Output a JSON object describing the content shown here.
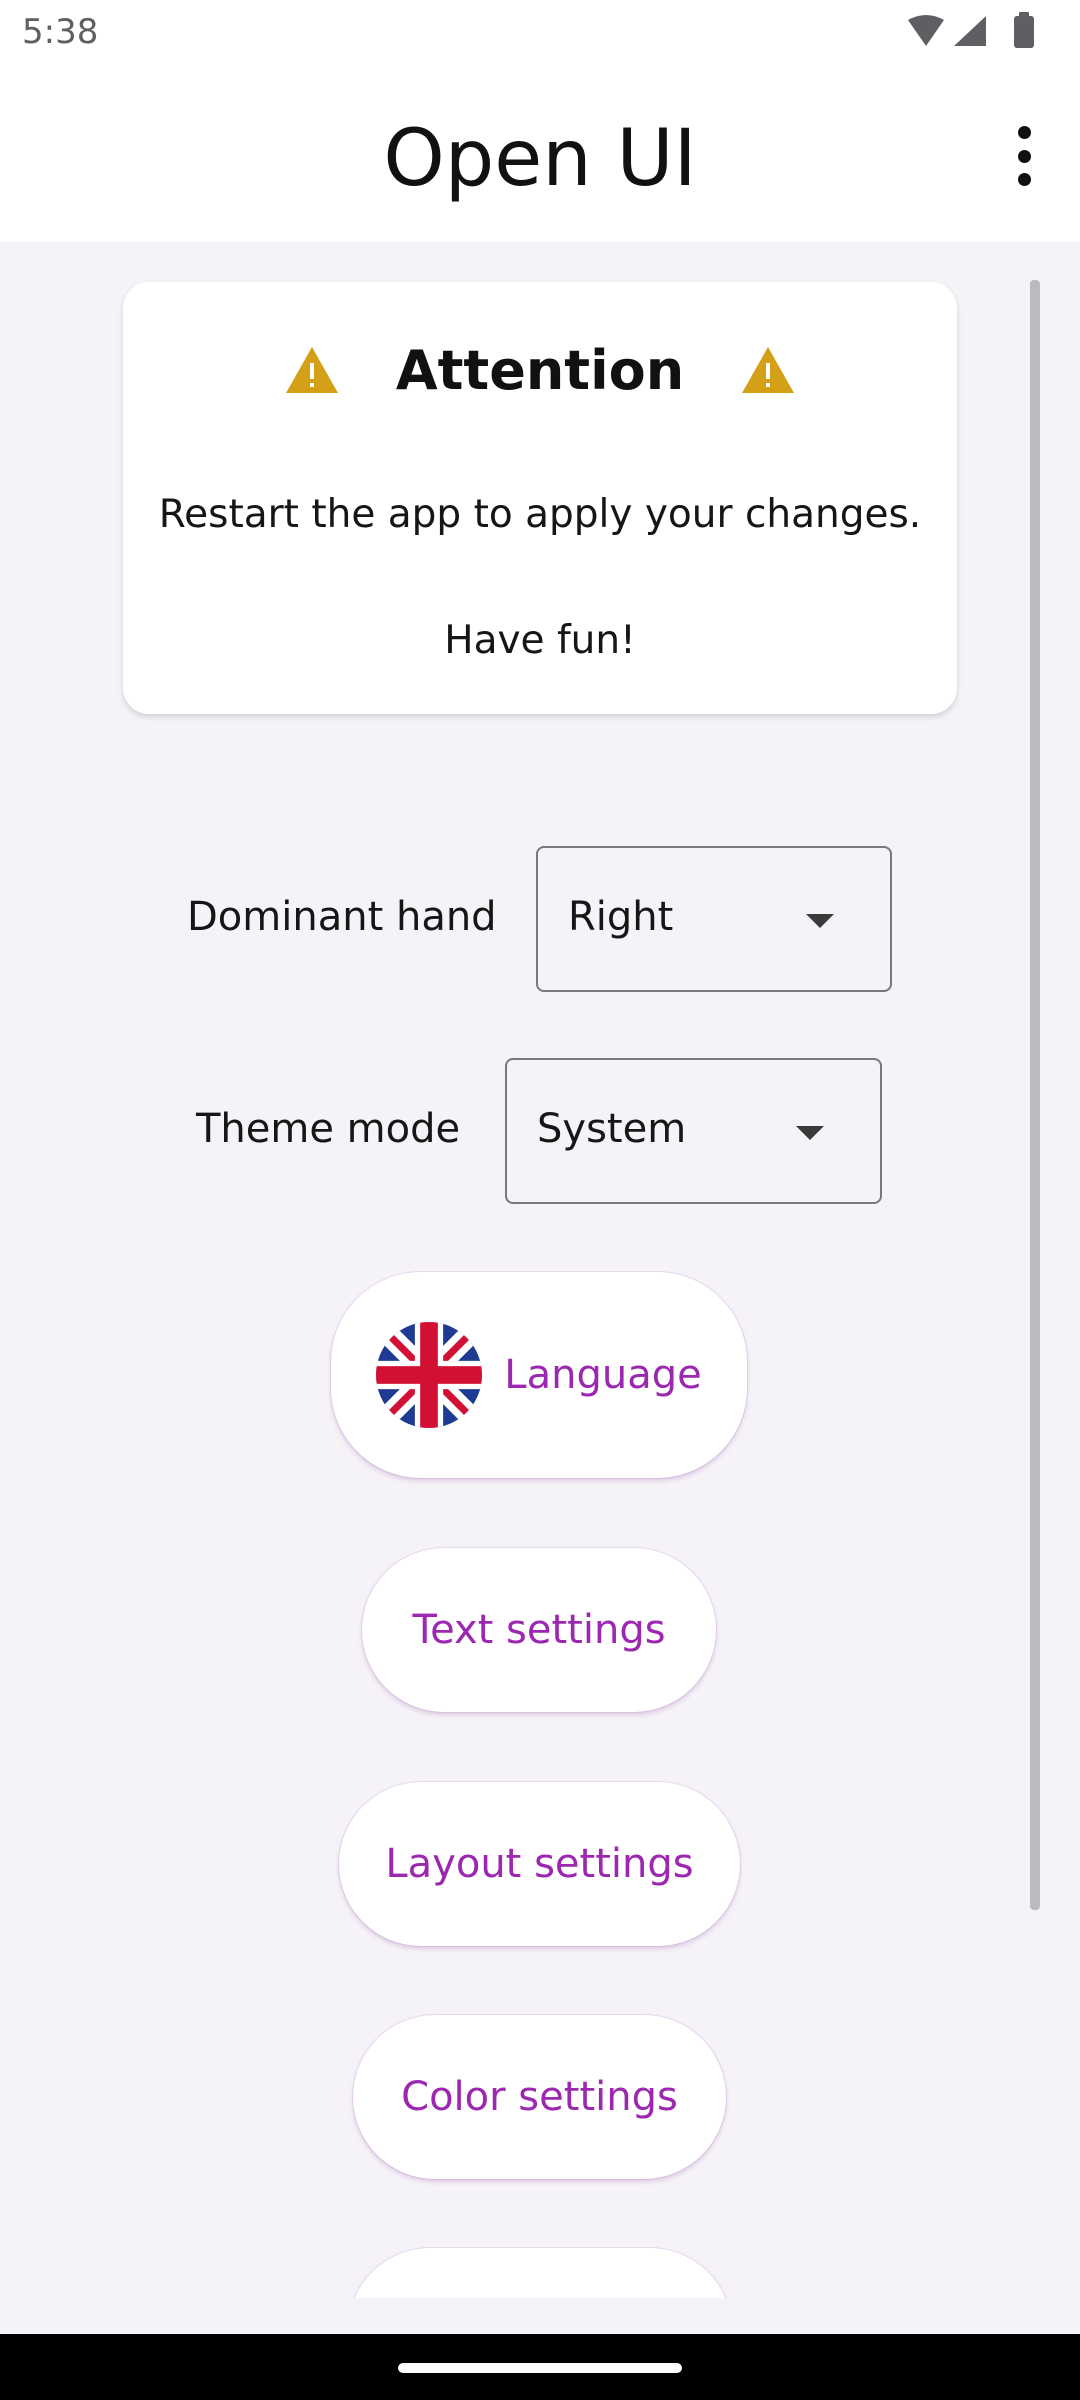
{
  "status_bar": {
    "time": "5:38"
  },
  "app_bar": {
    "title": "Open UI"
  },
  "attention": {
    "title": "Attention",
    "message": "Restart the app to apply your changes.",
    "fun": "Have fun!"
  },
  "settings": {
    "dominant_hand": {
      "label": "Dominant hand",
      "value": "Right"
    },
    "theme_mode": {
      "label": "Theme mode",
      "value": "System"
    }
  },
  "buttons": {
    "language": "Language",
    "text_settings": "Text settings",
    "layout_settings": "Layout settings",
    "color_settings": "Color settings"
  },
  "colors": {
    "accent": "#9c27b0",
    "warning": "#d4a017"
  },
  "icons": {
    "wifi": "wifi-icon",
    "signal": "signal-icon",
    "battery": "battery-icon",
    "overflow": "more-vert-icon",
    "warning": "warning-icon",
    "flag": "uk-flag-icon"
  }
}
